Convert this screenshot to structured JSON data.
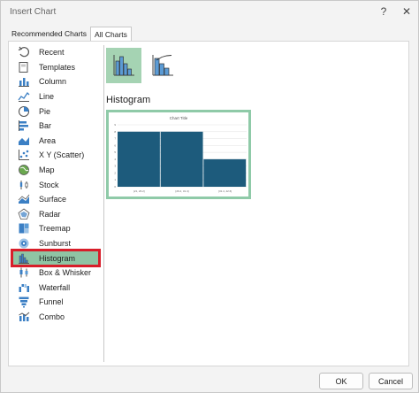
{
  "window": {
    "title": "Insert Chart"
  },
  "tabs": [
    {
      "label": "Recommended Charts",
      "active": false
    },
    {
      "label": "All Charts",
      "active": true
    }
  ],
  "sidebar": {
    "items": [
      {
        "label": "Recent",
        "icon": "recent-icon"
      },
      {
        "label": "Templates",
        "icon": "templates-icon"
      },
      {
        "label": "Column",
        "icon": "column-chart-icon"
      },
      {
        "label": "Line",
        "icon": "line-chart-icon"
      },
      {
        "label": "Pie",
        "icon": "pie-chart-icon"
      },
      {
        "label": "Bar",
        "icon": "bar-chart-icon"
      },
      {
        "label": "Area",
        "icon": "area-chart-icon"
      },
      {
        "label": "X Y (Scatter)",
        "icon": "scatter-chart-icon"
      },
      {
        "label": "Map",
        "icon": "map-chart-icon"
      },
      {
        "label": "Stock",
        "icon": "stock-chart-icon"
      },
      {
        "label": "Surface",
        "icon": "surface-chart-icon"
      },
      {
        "label": "Radar",
        "icon": "radar-chart-icon"
      },
      {
        "label": "Treemap",
        "icon": "treemap-chart-icon"
      },
      {
        "label": "Sunburst",
        "icon": "sunburst-chart-icon"
      },
      {
        "label": "Histogram",
        "icon": "histogram-chart-icon"
      },
      {
        "label": "Box & Whisker",
        "icon": "box-whisker-chart-icon"
      },
      {
        "label": "Waterfall",
        "icon": "waterfall-chart-icon"
      },
      {
        "label": "Funnel",
        "icon": "funnel-chart-icon"
      },
      {
        "label": "Combo",
        "icon": "combo-chart-icon"
      }
    ],
    "selected_label": "Histogram"
  },
  "main": {
    "section_title": "Histogram",
    "variants": [
      {
        "icon": "histogram-chart-icon",
        "selected": true
      },
      {
        "icon": "pareto-chart-icon",
        "selected": false
      }
    ]
  },
  "chart_data": {
    "type": "bar",
    "title": "Chart Title",
    "categories": [
      "[21, 26.2]",
      "[26.2, 31.4]",
      "[31.4, 42.6]"
    ],
    "values": [
      8,
      8,
      4
    ],
    "ylim": [
      0,
      9
    ],
    "yticks": [
      "0",
      "1",
      "2",
      "3",
      "4",
      "5",
      "6",
      "7",
      "8",
      "9"
    ],
    "grid": true,
    "bar_color": "#1d5b7c"
  },
  "footer": {
    "ok_label": "OK",
    "cancel_label": "Cancel"
  },
  "colors": {
    "accent_selected": "#8fc4a4",
    "highlight_border": "#d81e2a"
  }
}
